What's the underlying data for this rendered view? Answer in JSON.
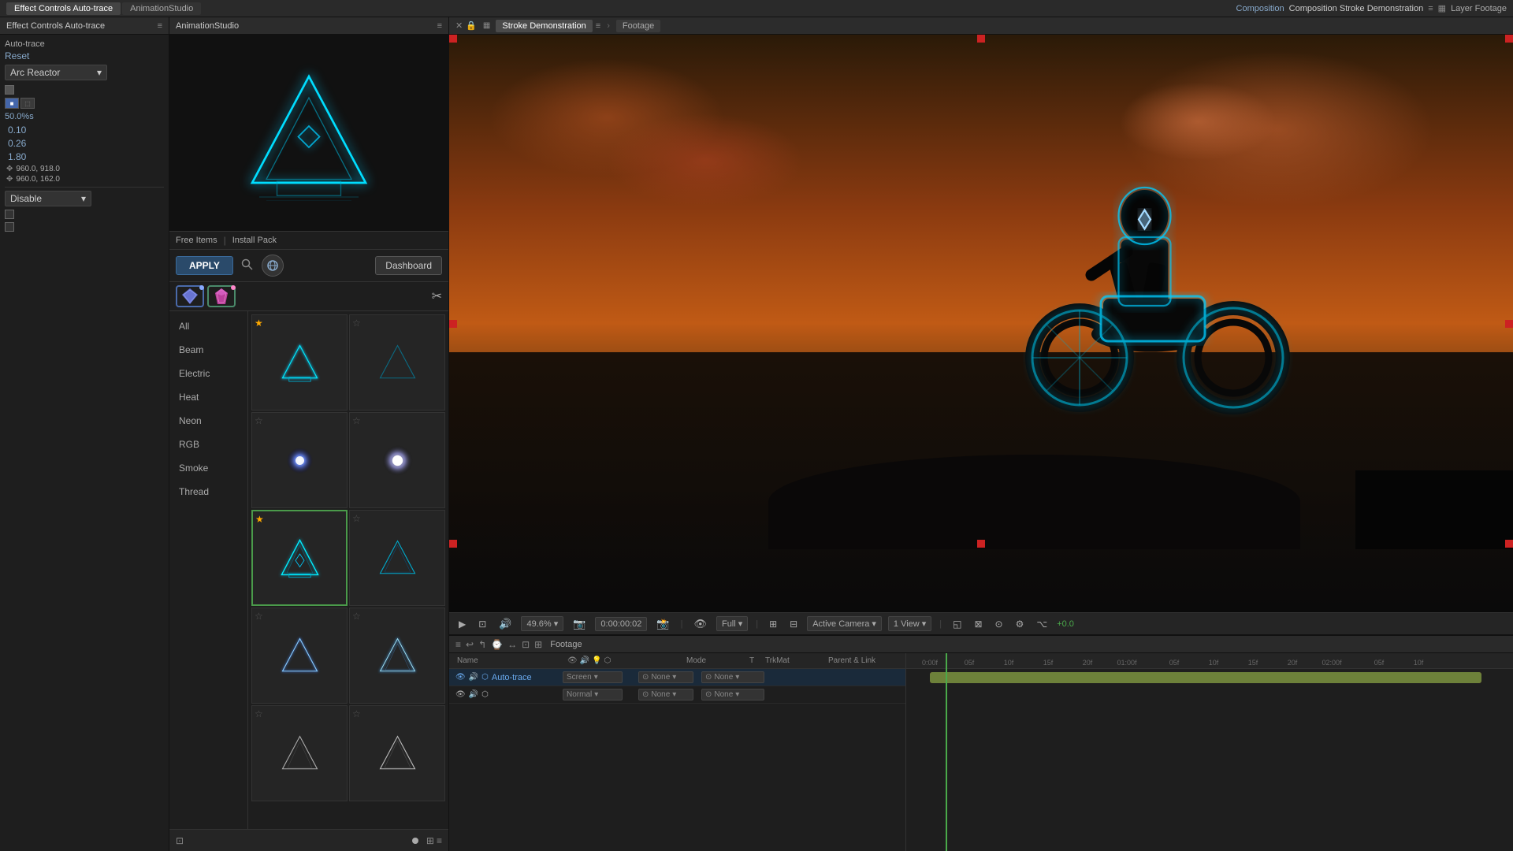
{
  "topbar": {
    "tabs": [
      {
        "label": "Effect Controls Auto-trace",
        "icon": "≡",
        "active": true
      },
      {
        "label": "AnimationStudio",
        "icon": "≡",
        "active": false
      }
    ]
  },
  "left_panel": {
    "title": "Effect Controls Auto-trace",
    "menu_icon": "≡",
    "layer_name": "Auto-trace",
    "reset_label": "Reset",
    "preset_dropdown": "Arc Reactor",
    "values": {
      "percent": "50.0",
      "percent_unit": "%s",
      "v1": "0.10",
      "v2": "0.26",
      "v3": "1.80",
      "coord1": "960.0, 918.0",
      "coord2": "960.0, 162.0"
    },
    "disable_dropdown": "Disable"
  },
  "center_panel": {
    "title": "AnimationStudio",
    "menu_icon": "≡",
    "nav_links": [
      "Free Items",
      "Install Pack"
    ],
    "apply_btn": "APPLY",
    "dashboard_btn": "Dashboard",
    "tabs": [
      {
        "type": "diamond",
        "color": "#7a88ff",
        "active": false
      },
      {
        "type": "gem",
        "color": "#ff44aa",
        "active": true
      }
    ],
    "categories": [
      {
        "label": "All",
        "active": false
      },
      {
        "label": "Beam",
        "active": false
      },
      {
        "label": "Electric",
        "active": false
      },
      {
        "label": "Heat",
        "active": false
      },
      {
        "label": "Neon",
        "active": false
      },
      {
        "label": "RGB",
        "active": false
      },
      {
        "label": "Smoke",
        "active": false
      },
      {
        "label": "Thread",
        "active": false
      }
    ],
    "effects": [
      {
        "star": true,
        "selected": false,
        "type": "triangle-cyan",
        "row": 1,
        "col": 1
      },
      {
        "star": false,
        "selected": false,
        "type": "triangle-cyan-dim",
        "row": 1,
        "col": 2
      },
      {
        "star": false,
        "selected": false,
        "type": "glow-white",
        "row": 2,
        "col": 1
      },
      {
        "star": false,
        "selected": false,
        "type": "glow-white-bright",
        "row": 2,
        "col": 2
      },
      {
        "star": true,
        "selected": true,
        "type": "triangle-selected",
        "row": 3,
        "col": 1
      },
      {
        "star": false,
        "selected": false,
        "type": "triangle-cyan2",
        "row": 3,
        "col": 2
      },
      {
        "star": false,
        "selected": false,
        "type": "triangle-neon1",
        "row": 4,
        "col": 1
      },
      {
        "star": false,
        "selected": false,
        "type": "triangle-neon2",
        "row": 4,
        "col": 2
      },
      {
        "star": false,
        "selected": false,
        "type": "triangle-outline1",
        "row": 5,
        "col": 1
      },
      {
        "star": false,
        "selected": false,
        "type": "triangle-outline2",
        "row": 5,
        "col": 2
      }
    ]
  },
  "composition": {
    "title": "Composition Stroke Demonstration",
    "tabs": [
      {
        "label": "Stroke Demonstration",
        "active": true
      },
      {
        "label": "Footage",
        "active": false
      }
    ],
    "layer_footage_tab": "Layer Footage",
    "viewport": {
      "zoom": "49.6%",
      "timecode": "0:00:00:02",
      "quality": "Full",
      "camera": "Active Camera",
      "view": "1 View",
      "offset": "+0.0"
    }
  },
  "timeline": {
    "header_icons": [
      "≡",
      "↩",
      "↰",
      "↱",
      "⌚",
      "▶"
    ],
    "col_headers": [
      "Name",
      "",
      "",
      "Mode",
      "T",
      "TrkMat",
      "Parent & Link"
    ],
    "rows": [
      {
        "name": "Auto-trace",
        "mode": "Screen",
        "t": "",
        "trkmat": "None",
        "parent": "None",
        "is_blue": true
      },
      {
        "name": "",
        "mode": "Normal",
        "t": "",
        "trkmat": "None",
        "parent": "None",
        "is_blue": false
      }
    ],
    "footage_label": "Footage",
    "time_markers": [
      "05f",
      "10f",
      "15f",
      "20f",
      "01:00f",
      "05f",
      "10f",
      "15f",
      "20f",
      "02:00f",
      "05f",
      "10f"
    ]
  }
}
